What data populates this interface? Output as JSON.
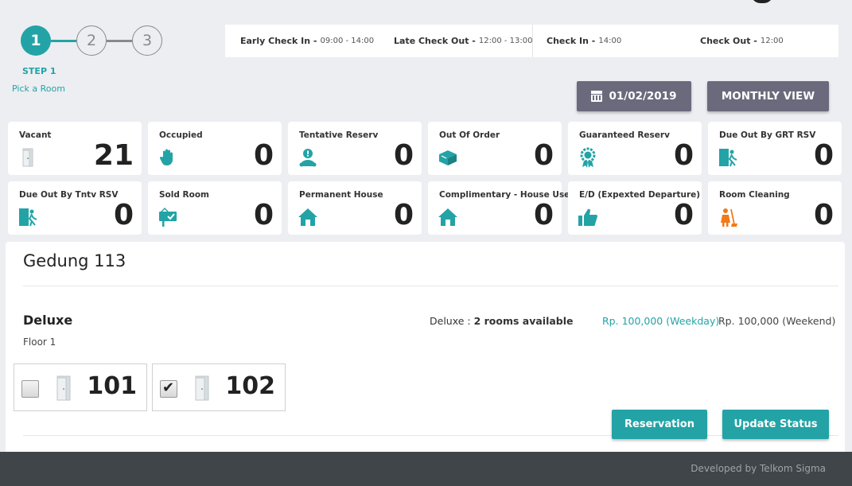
{
  "stepper": {
    "steps": [
      "1",
      "2",
      "3"
    ],
    "current_label": "STEP 1",
    "current_sub": "Pick a Room"
  },
  "times": {
    "early_checkin_label": "Early Check In -",
    "early_checkin_value": "09:00 - 14:00",
    "late_checkout_label": "Late Check Out -",
    "late_checkout_value": "12:00 - 13:00",
    "checkin_label": "Check In -",
    "checkin_value": "14:00",
    "checkout_label": "Check Out -",
    "checkout_value": "12:00"
  },
  "toolbar": {
    "date": "01/02/2019",
    "view_label": "MONTHLY VIEW"
  },
  "status_cards": [
    {
      "label": "Vacant",
      "value": "21",
      "icon": "door-icon"
    },
    {
      "label": "Occupied",
      "value": "0",
      "icon": "hand-icon"
    },
    {
      "label": "Tentative Reserv",
      "value": "0",
      "icon": "person-alert-icon"
    },
    {
      "label": "Out Of Order",
      "value": "0",
      "icon": "box-icon"
    },
    {
      "label": "Guaranteed Reserv",
      "value": "0",
      "icon": "badge-icon"
    },
    {
      "label": "Due Out By GRT RSV",
      "value": "0",
      "icon": "exit-door-icon"
    },
    {
      "label": "Due Out By Tntv RSV",
      "value": "0",
      "icon": "exit-door-icon"
    },
    {
      "label": "Sold Room",
      "value": "0",
      "icon": "sold-sign-icon"
    },
    {
      "label": "Permanent House",
      "value": "0",
      "icon": "house-icon"
    },
    {
      "label": "Complimentary - House Use",
      "value": "0",
      "icon": "house-icon"
    },
    {
      "label": "E/D (Expexted Departure)",
      "value": "0",
      "icon": "thumbs-up-icon"
    },
    {
      "label": "Room Cleaning",
      "value": "0",
      "icon": "cleaning-icon"
    }
  ],
  "building": {
    "name": "Gedung 113",
    "room_type": "Deluxe",
    "floor": "Floor 1",
    "availability_prefix": "Deluxe : ",
    "availability_value": "2 rooms available",
    "price_weekday": "Rp. 100,000 (Weekday)",
    "price_weekend": "Rp. 100,000 (Weekend)",
    "rooms": [
      {
        "number": "101",
        "checked": false
      },
      {
        "number": "102",
        "checked": true
      }
    ]
  },
  "actions": {
    "reservation": "Reservation",
    "update_status": "Update Status"
  },
  "footer": {
    "text": "Developed by Telkom Sigma"
  },
  "colors": {
    "accent": "#23a3a6",
    "dark_button": "#6b6a7d",
    "cleaning_orange": "#f07a1a",
    "footer": "#3f4549"
  }
}
